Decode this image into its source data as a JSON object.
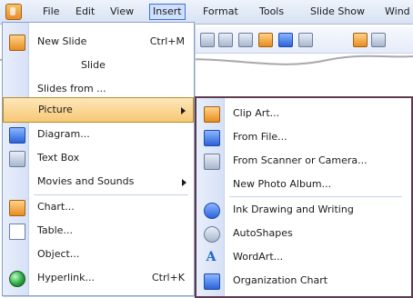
{
  "menubar": {
    "items": [
      {
        "label": "File"
      },
      {
        "label": "Edit"
      },
      {
        "label": "View"
      },
      {
        "label": "Insert"
      },
      {
        "label": "Format"
      },
      {
        "label": "Tools"
      },
      {
        "label": "Slide Show"
      },
      {
        "label": "Wind"
      }
    ]
  },
  "insert_menu": {
    "items": [
      {
        "label": "New Slide",
        "shortcut": "Ctrl+M"
      },
      {
        "label": "Slide"
      },
      {
        "label": "Slides from ..."
      },
      {
        "label": "Picture",
        "has_submenu": true
      },
      {
        "label": "Diagram..."
      },
      {
        "label": "Text Box"
      },
      {
        "label": "Movies and Sounds",
        "has_submenu": true
      },
      {
        "label": "Chart..."
      },
      {
        "label": "Table..."
      },
      {
        "label": "Object..."
      },
      {
        "label": "Hyperlink...",
        "shortcut": "Ctrl+K"
      }
    ]
  },
  "picture_menu": {
    "items": [
      {
        "label": "Clip Art..."
      },
      {
        "label": "From File..."
      },
      {
        "label": "From Scanner or Camera..."
      },
      {
        "label": "New Photo Album..."
      },
      {
        "label": "Ink Drawing and Writing"
      },
      {
        "label": "AutoShapes"
      },
      {
        "label": "WordArt..."
      },
      {
        "label": "Organization Chart"
      }
    ]
  },
  "colors": {
    "highlight": "#f7c875",
    "menubar_active": "#cfe0ff",
    "submenu_border": "#5d3a4e"
  }
}
